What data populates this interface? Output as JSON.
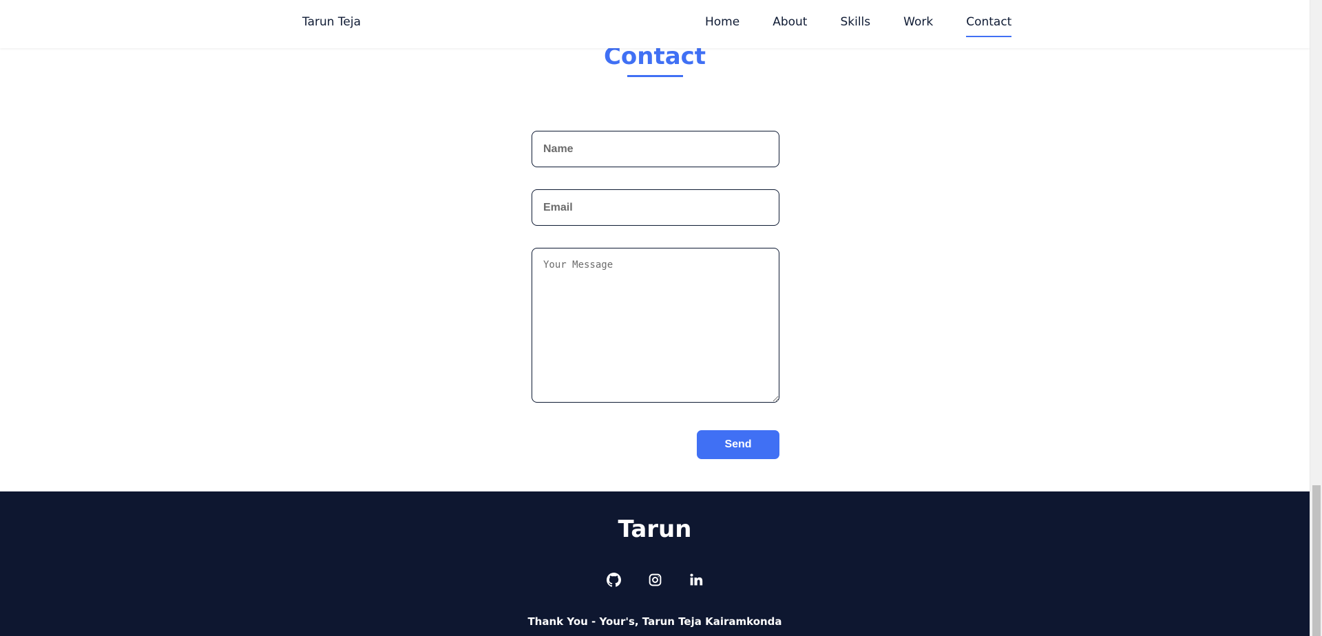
{
  "header": {
    "brand": "Tarun Teja",
    "nav": [
      {
        "label": "Home"
      },
      {
        "label": "About"
      },
      {
        "label": "Skills"
      },
      {
        "label": "Work"
      },
      {
        "label": "Contact",
        "active": true
      }
    ]
  },
  "contact": {
    "title": "Contact",
    "name_placeholder": "Name",
    "email_placeholder": "Email",
    "message_placeholder": "Your Message",
    "send_label": "Send"
  },
  "footer": {
    "title": "Tarun",
    "social_icons": [
      "github-icon",
      "instagram-icon",
      "linkedin-icon"
    ],
    "note": "Thank You - Your's, Tarun Teja Kairamkonda"
  },
  "colors": {
    "accent": "#4070f4",
    "footer_bg": "#0e1730",
    "text": "#0e1a33"
  }
}
